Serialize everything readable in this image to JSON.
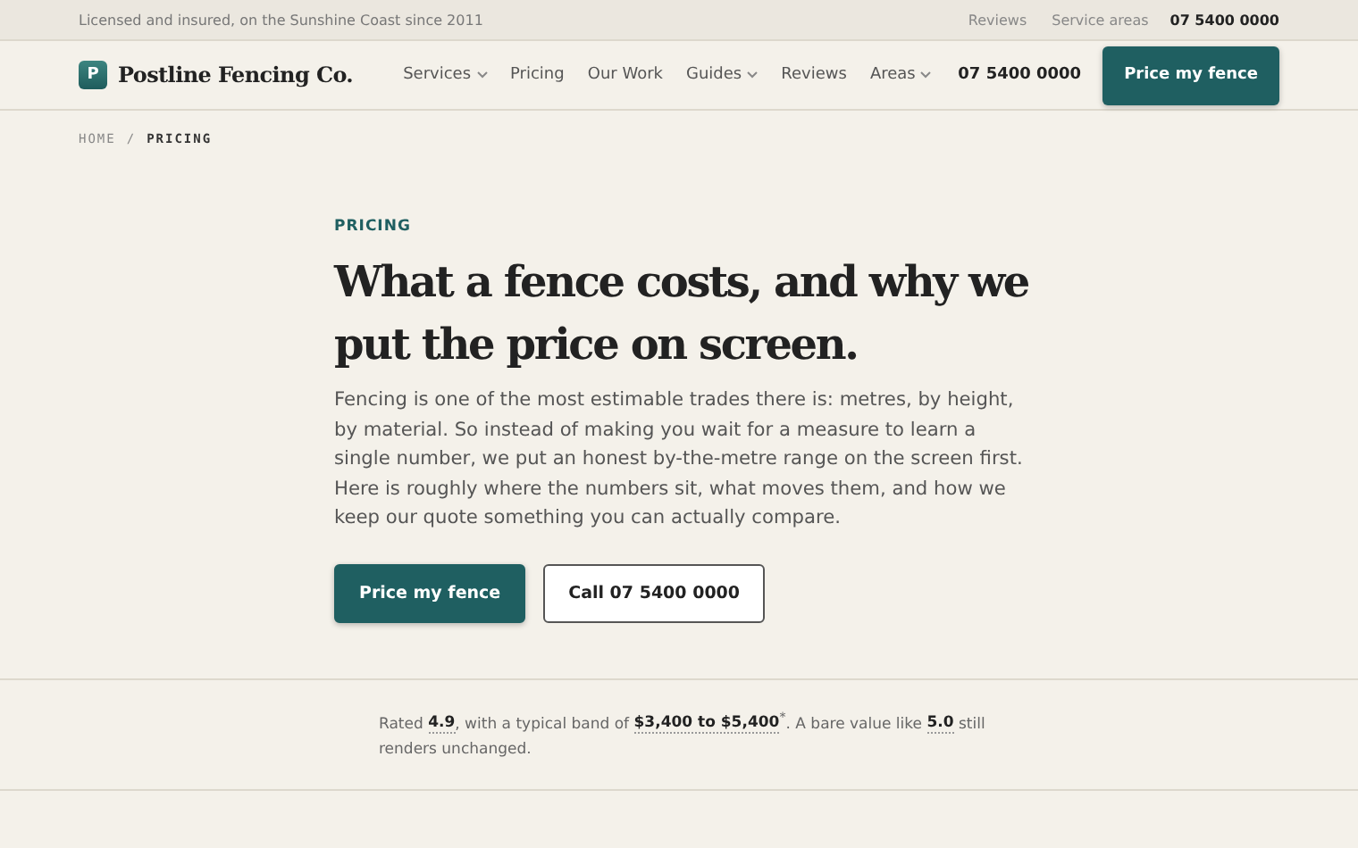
{
  "topbar": {
    "tagline": "Licensed and insured, on the Sunshine Coast since 2011",
    "links": [
      "Reviews",
      "Service areas"
    ],
    "phone": "07 5400 0000"
  },
  "nav": {
    "logo_letter": "P",
    "brand": "Postline Fencing Co.",
    "items": [
      {
        "label": "Services",
        "dropdown": true
      },
      {
        "label": "Pricing",
        "dropdown": false
      },
      {
        "label": "Our Work",
        "dropdown": false
      },
      {
        "label": "Guides",
        "dropdown": true
      },
      {
        "label": "Reviews",
        "dropdown": false
      },
      {
        "label": "Areas",
        "dropdown": true
      }
    ],
    "phone": "07 5400 0000",
    "cta": "Price my fence"
  },
  "breadcrumb": {
    "items": [
      "HOME",
      "PRICING"
    ],
    "separator": "/"
  },
  "hero": {
    "eyebrow": "PRICING",
    "heading": "What a fence costs, and why we put the price on screen.",
    "body": "Fencing is one of the most estimable trades there is: metres, by height, by material. So instead of making you wait for a measure to learn a single number, we put an honest by-the-metre range on the screen first. Here is roughly where the numbers sit, what moves them, and how we keep our quote something you can actually compare.",
    "buttons": [
      {
        "label": "Price my fence",
        "kind": "primary"
      },
      {
        "label": "Call 07 5400 0000",
        "kind": "secondary"
      }
    ]
  },
  "note": {
    "text": "Rated **4.9**, with a typical band of **$3,400 to $5,400**$^{*}$. A bare value like **5.0** still renders unchanged."
  }
}
